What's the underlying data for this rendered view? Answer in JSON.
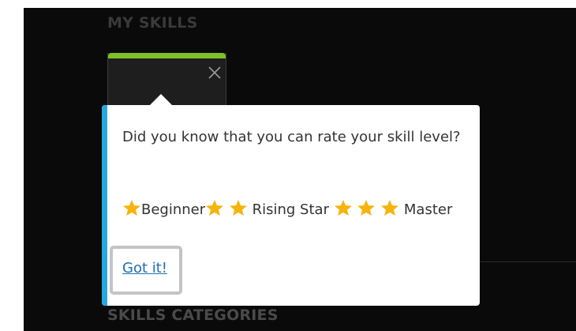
{
  "sections": {
    "my_skills_heading": "MY SKILLS",
    "categories_heading": "SKILLS CATEGORIES"
  },
  "skill_card": {
    "accent_color": "#7fbf2a",
    "close_icon": "close-icon"
  },
  "popover": {
    "accent_color": "#29a7e1",
    "message": "Did you know that you can rate your skill level?",
    "levels": [
      {
        "stars": 1,
        "label": "Beginner"
      },
      {
        "stars": 2,
        "label": "Rising Star"
      },
      {
        "stars": 3,
        "label": "Master"
      }
    ],
    "star_icon": "star-icon",
    "star_color": "#f6b40e",
    "dismiss_label": "Got it!"
  }
}
